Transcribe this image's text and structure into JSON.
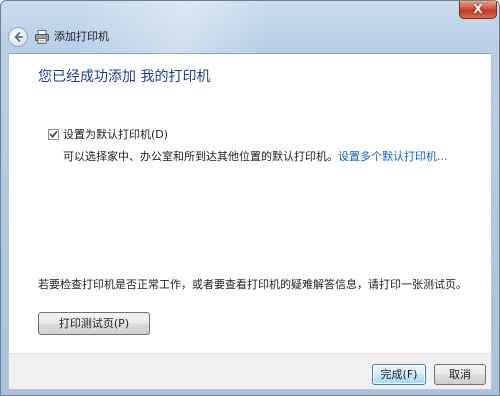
{
  "window": {
    "title": "添加打印机",
    "close_label": "X"
  },
  "icons": {
    "back": "back-arrow-icon",
    "printer": "printer-icon",
    "checkmark": "checkmark-icon"
  },
  "main": {
    "heading": "您已经成功添加 我的打印机",
    "default_checkbox": {
      "label": "设置为默认打印机(D)",
      "checked": true
    },
    "description": "可以选择家中、办公室和所到达其他位置的默认打印机。",
    "description_link": "设置多个默认打印机...",
    "check_info": "若要检查打印机是否正常工作，或者要查看打印机的疑难解答信息，请打印一张测试页。",
    "test_page_button": "打印测试页(P)"
  },
  "footer": {
    "finish_button": "完成(F)",
    "cancel_button": "取消"
  },
  "colors": {
    "heading": "#1c3f95",
    "link": "#0b63c8",
    "frame": "#b8cfe6",
    "close_button": "#c03a22"
  }
}
